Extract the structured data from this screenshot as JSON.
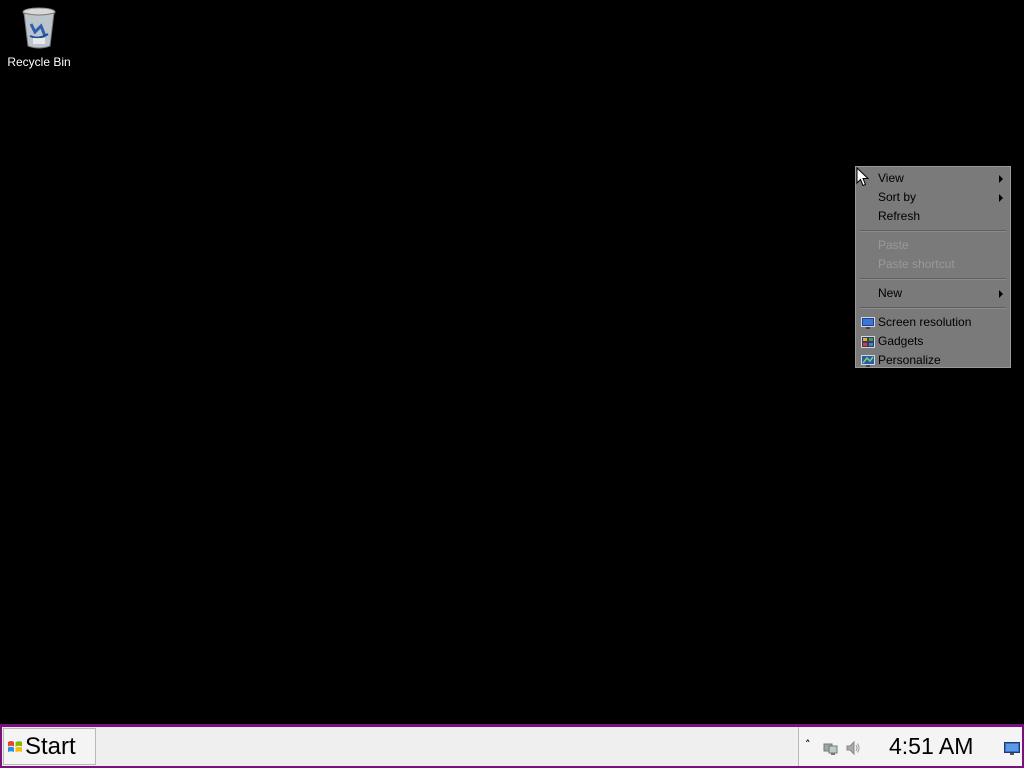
{
  "desktop": {
    "icons": [
      {
        "label": "Recycle Bin",
        "icon": "recycle-bin-icon"
      }
    ]
  },
  "context_menu": {
    "items": [
      {
        "label": "View",
        "submenu": true,
        "enabled": true
      },
      {
        "label": "Sort by",
        "submenu": true,
        "enabled": true
      },
      {
        "label": "Refresh",
        "submenu": false,
        "enabled": true
      },
      {
        "label": "Paste",
        "submenu": false,
        "enabled": false
      },
      {
        "label": "Paste shortcut",
        "submenu": false,
        "enabled": false
      },
      {
        "label": "New",
        "submenu": true,
        "enabled": true
      },
      {
        "label": "Screen resolution",
        "icon": "screen-resolution-icon",
        "enabled": true
      },
      {
        "label": "Gadgets",
        "icon": "gadgets-icon",
        "enabled": true
      },
      {
        "label": "Personalize",
        "icon": "personalize-icon",
        "enabled": true
      }
    ]
  },
  "taskbar": {
    "start_label": "Start",
    "clock": "4:51 AM",
    "tray_icons": [
      "show-hidden-icons",
      "network-icon",
      "volume-icon",
      "show-desktop-icon"
    ],
    "accent_color": "#7b0f7c"
  }
}
